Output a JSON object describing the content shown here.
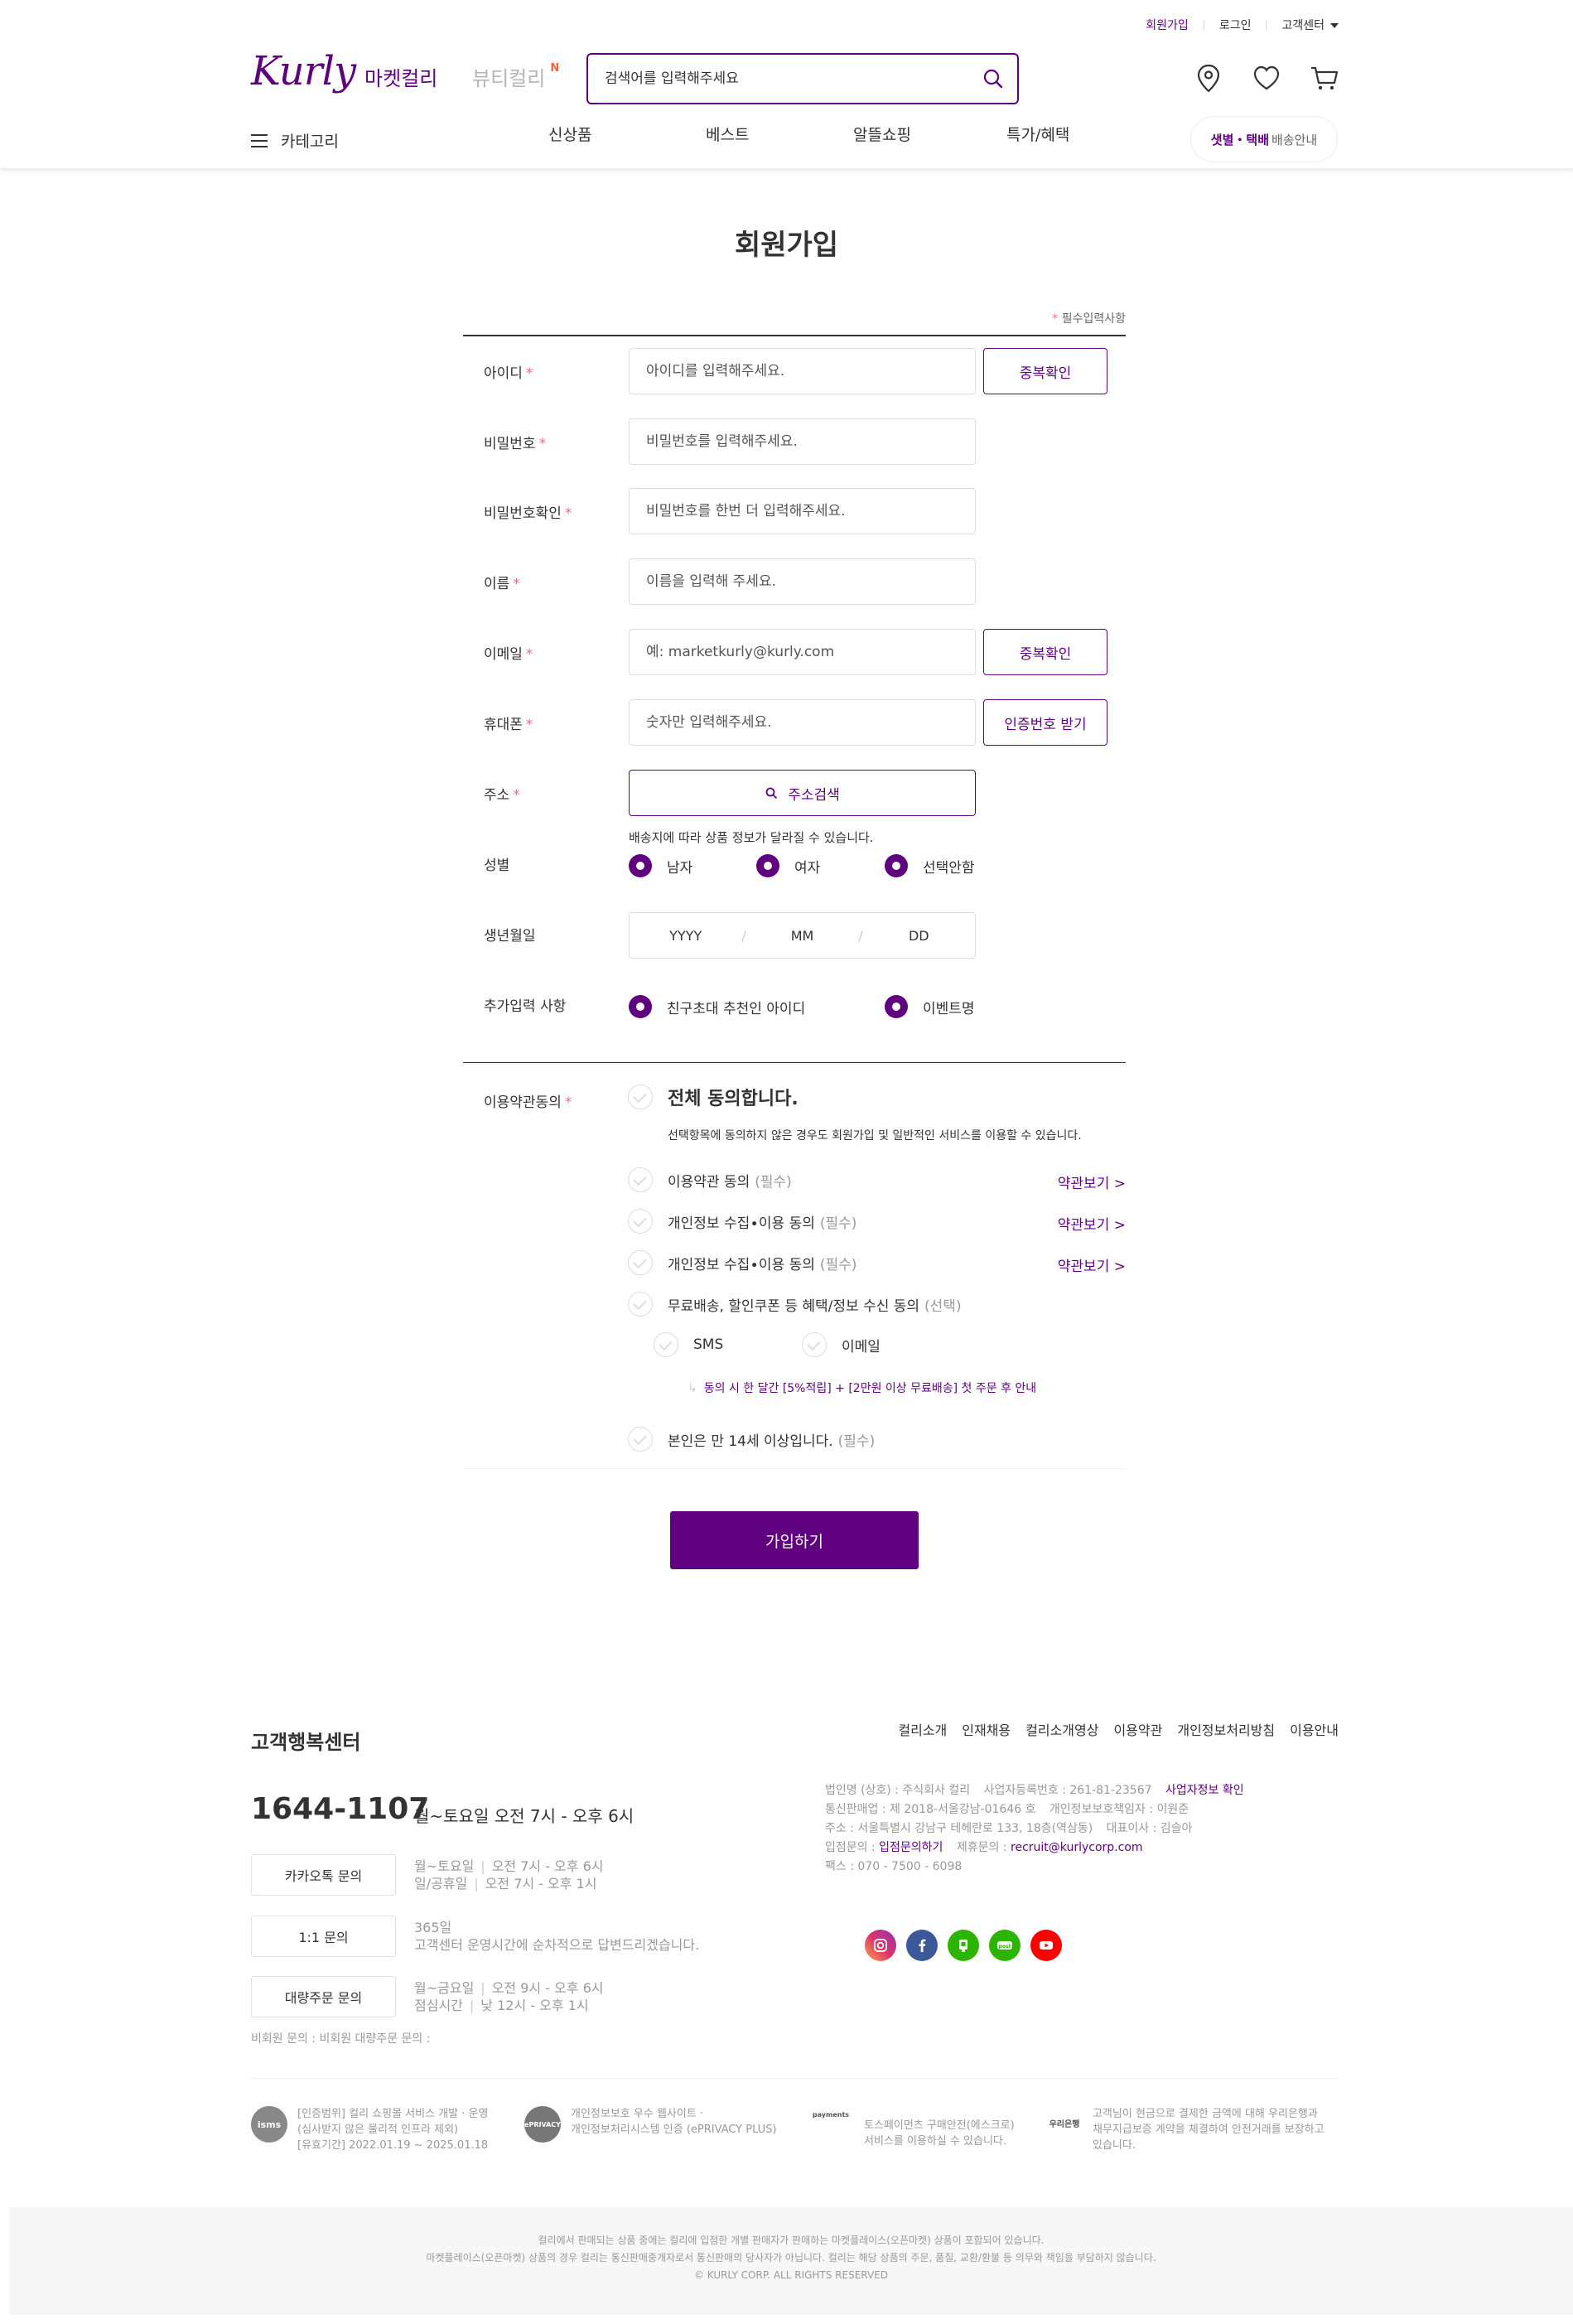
{
  "header": {
    "top_links": {
      "signup": "회원가입",
      "login": "로그인",
      "customer_center": "고객센터"
    },
    "logo": "Kurly",
    "tabs": {
      "market": "마켓컬리",
      "beauty": "뷰티컬리",
      "beauty_badge": "N"
    },
    "search": {
      "placeholder": "검색어를 입력해주세요"
    },
    "category": "카테고리",
    "gnb": [
      "신상품",
      "베스트",
      "알뜰쇼핑",
      "특가/혜택"
    ],
    "delivery": {
      "bold": "샛별・택배",
      "rest": "배송안내"
    }
  },
  "form": {
    "title": "회원가입",
    "required_note": "필수입력사항",
    "required_star": "*",
    "fields": {
      "id": {
        "label": "아이디",
        "placeholder": "아이디를 입력해주세요.",
        "button": "중복확인"
      },
      "password": {
        "label": "비밀번호",
        "placeholder": "비밀번호를 입력해주세요."
      },
      "password_confirm": {
        "label": "비밀번호확인",
        "placeholder": "비밀번호를 한번 더 입력해주세요."
      },
      "name": {
        "label": "이름",
        "placeholder": "이름을 입력해 주세요."
      },
      "email": {
        "label": "이메일",
        "placeholder": "예: marketkurly@kurly.com",
        "button": "중복확인"
      },
      "phone": {
        "label": "휴대폰",
        "placeholder": "숫자만 입력해주세요.",
        "button": "인증번호 받기"
      },
      "address": {
        "label": "주소",
        "button": "주소검색",
        "note": "배송지에 따라 상품 정보가 달라질 수 있습니다."
      },
      "gender": {
        "label": "성별",
        "options": [
          "남자",
          "여자",
          "선택안함"
        ]
      },
      "birth": {
        "label": "생년월일",
        "year": "YYYY",
        "month": "MM",
        "day": "DD"
      },
      "extra": {
        "label": "추가입력 사항",
        "options": [
          "친구초대 추천인 아이디",
          "이벤트명"
        ]
      }
    },
    "terms": {
      "label": "이용약관동의",
      "all": "전체 동의합니다.",
      "all_note": "선택항목에 동의하지 않은 경우도 회원가입 및 일반적인 서비스를 이용할 수 있습니다.",
      "items": [
        {
          "text": "이용약관 동의",
          "tag": "(필수)",
          "link": "약관보기 >"
        },
        {
          "text": "개인정보 수집∙이용 동의",
          "tag": "(필수)",
          "link": "약관보기 >"
        },
        {
          "text": "개인정보 수집∙이용 동의",
          "tag": "(필수)",
          "link": "약관보기 >"
        },
        {
          "text": "무료배송, 할인쿠폰 등 혜택/정보 수신 동의",
          "tag": "(선택)"
        }
      ],
      "sms": "SMS",
      "email": "이메일",
      "benefit": "동의 시 한 달간 [5%적립] + [2만원 이상 무료배송] 첫 주문 후 안내",
      "age": {
        "text": "본인은 만 14세 이상입니다.",
        "tag": "(필수)"
      }
    },
    "submit": "가입하기"
  },
  "footer": {
    "cs_title": "고객행복센터",
    "phone": "1644-1107",
    "phone_hours": "월~토요일 오전 7시 - 오후 6시",
    "kakao": {
      "button": "카카오톡 문의",
      "line1a": "월~토요일",
      "line1b": "오전 7시 - 오후 6시",
      "line2a": "일/공휴일",
      "line2b": "오전 7시 - 오후 1시"
    },
    "one_on_one": {
      "button": "1:1 문의",
      "line1": "365일",
      "line2": "고객센터 운영시간에 순차적으로 답변드리겠습니다."
    },
    "bulk": {
      "button": "대량주문 문의",
      "line1a": "월~금요일",
      "line1b": "오전 9시 - 오후 6시",
      "line2a": "점심시간",
      "line2b": "낮 12시 - 오후 1시"
    },
    "nonmember": "비회원 문의 : 비회원 대량주문 문의 :",
    "links": [
      "컬리소개",
      "인재채용",
      "컬리소개영상",
      "이용약관",
      "개인정보처리방침",
      "이용안내"
    ],
    "company": {
      "l1": "법인명 (상호) : 주식회사 컬리",
      "l1b": "사업자등록번호 : 261-81-23567",
      "l1c": "사업자정보 확인",
      "l2": "통신판매업 : 제 2018-서울강남-01646 호",
      "l2b": "개인정보보호책임자 : 이원준",
      "l3": "주소 : 서울특별시 강남구 테헤란로 133, 18층(역삼동)",
      "l3b": "대표이사 : 김슬아",
      "l4": "입점문의 :",
      "l4b": "입점문의하기",
      "l4c": "제휴문의 :",
      "l4d": "recruit@kurlycorp.com",
      "l5": "팩스 : 070 - 7500 - 6098"
    },
    "certs": [
      {
        "badge": "isms",
        "t1": "[인증범위] 컬리 쇼핑몰 서비스 개발 · 운영",
        "t2": "(심사받지 않은 물리적 인프라 제외)",
        "t3": "[유효기간] 2022.01.19 ~ 2025.01.18"
      },
      {
        "badge": "ePRIVACY",
        "t1": "개인정보보호 우수 웹사이트 ·",
        "t2": "개인정보처리시스템 인증 (ePRIVACY PLUS)"
      },
      {
        "badge": "payments",
        "t1": "토스페이먼츠 구매안전(에스크로)",
        "t2": "서비스를 이용하실 수 있습니다."
      },
      {
        "badge": "우리은행",
        "t1": "고객님이 현금으로 결제한 금액에 대해 우리은행과",
        "t2": "채무지급보증 계약을 체결하여 안전거래를 보장하고",
        "t3": "있습니다."
      }
    ],
    "bottom1": "컬리에서 판매되는 상품 중에는 컬리에 입점한 개별 판매자가 판매하는 마켓플레이스(오픈마켓) 상품이 포함되어 있습니다.",
    "bottom2": "마켓플레이스(오픈마켓) 상품의 경우 컬리는 통신판매중개자로서 통신판매의 당사자가 아닙니다. 컬리는 해당 상품의 주문, 품질, 교환/환불 등 의무와 책임을 부담하지 않습니다.",
    "copyright": "© KURLY CORP. ALL RIGHTS RESERVED"
  },
  "colors": {
    "brand": "#5f0080",
    "required": "#ee6a7b"
  }
}
